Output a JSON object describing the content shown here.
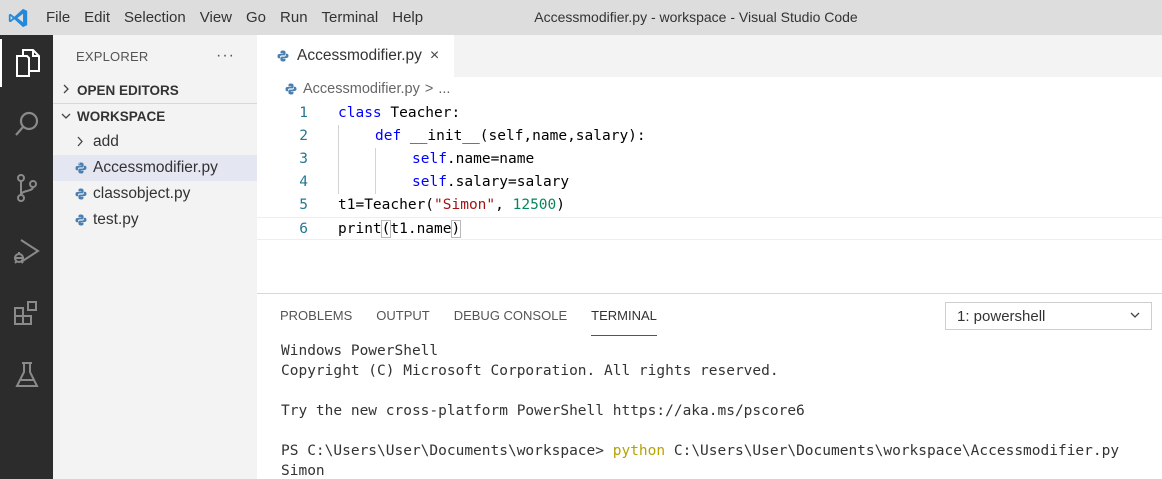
{
  "window": {
    "title": "Accessmodifier.py - workspace - Visual Studio Code",
    "menu": [
      "File",
      "Edit",
      "Selection",
      "View",
      "Go",
      "Run",
      "Terminal",
      "Help"
    ]
  },
  "activity_bar": {
    "icons": [
      "explorer-icon",
      "search-icon",
      "source-control-icon",
      "run-debug-icon",
      "extensions-icon",
      "testing-icon"
    ]
  },
  "sidebar": {
    "title": "EXPLORER",
    "more": "···",
    "open_editors": "OPEN EDITORS",
    "workspace": "WORKSPACE",
    "items": [
      {
        "label": "add",
        "type": "folder"
      },
      {
        "label": "Accessmodifier.py",
        "type": "python",
        "selected": true
      },
      {
        "label": "classobject.py",
        "type": "python"
      },
      {
        "label": "test.py",
        "type": "python"
      }
    ]
  },
  "editor": {
    "tab_label": "Accessmodifier.py",
    "close_glyph": "×",
    "breadcrumb_file": "Accessmodifier.py",
    "breadcrumb_sep": ">",
    "breadcrumb_rest": "...",
    "line_numbers": [
      "1",
      "2",
      "3",
      "4",
      "5",
      "6"
    ],
    "code": {
      "l1_kw": "class",
      "l1_rest": " Teacher:",
      "l2_kw": "def",
      "l2_rest": " __init__(self,name,salary):",
      "l3_kw": "self",
      "l3_rest": ".name=name",
      "l4_kw": "self",
      "l4_rest": ".salary=salary",
      "l5_a": "t1=Teacher(",
      "l5_str": "\"Simon\"",
      "l5_b": ", ",
      "l5_num": "12500",
      "l5_c": ")",
      "l6_a": "print",
      "l6_open": "(",
      "l6_b": "t1.name",
      "l6_close": ")"
    }
  },
  "panel": {
    "tabs": [
      "PROBLEMS",
      "OUTPUT",
      "DEBUG CONSOLE",
      "TERMINAL"
    ],
    "active_tab": "TERMINAL",
    "terminal_select": "1: powershell",
    "terminal": {
      "l1": "Windows PowerShell",
      "l2": "Copyright (C) Microsoft Corporation. All rights reserved.",
      "l3": "",
      "l4": "Try the new cross-platform PowerShell https://aka.ms/pscore6",
      "l5": "",
      "prompt": "PS C:\\Users\\User\\Documents\\workspace> ",
      "cmd": "python",
      "args": " C:\\Users\\User\\Documents\\workspace\\Accessmodifier.py",
      "output": "Simon"
    }
  },
  "colors": {
    "activity_bar": "#2c2c2c",
    "title_bar": "#dddddd",
    "sidebar": "#f3f3f3",
    "keyword": "#0000ff",
    "string": "#a31515",
    "number": "#098658",
    "line_number": "#237893",
    "vscode_blue": "#2489db",
    "python_icon": "#4a7fb0"
  }
}
